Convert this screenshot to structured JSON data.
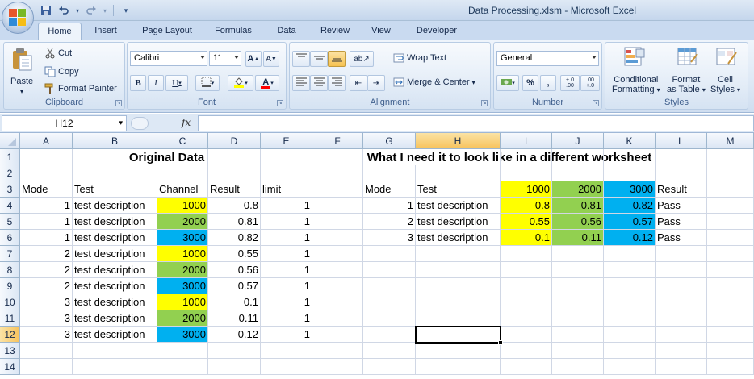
{
  "window": {
    "title": "Data Processing.xlsm - Microsoft Excel",
    "title_blurred": ""
  },
  "tabs": [
    {
      "label": "Home",
      "active": true
    },
    {
      "label": "Insert"
    },
    {
      "label": "Page Layout"
    },
    {
      "label": "Formulas"
    },
    {
      "label": "Data"
    },
    {
      "label": "Review"
    },
    {
      "label": "View"
    },
    {
      "label": "Developer"
    }
  ],
  "ribbon": {
    "clipboard": {
      "label": "Clipboard",
      "paste": "Paste",
      "cut": "Cut",
      "copy": "Copy",
      "format_painter": "Format Painter"
    },
    "font": {
      "label": "Font",
      "family": "Calibri",
      "size": "11",
      "grow": "A",
      "shrink": "A",
      "bold": "B",
      "italic": "I",
      "underline": "U",
      "font_color_letter": "A"
    },
    "alignment": {
      "label": "Alignment",
      "wrap_text": "Wrap Text",
      "merge_center": "Merge & Center"
    },
    "number": {
      "label": "Number",
      "format": "General",
      "percent": "%",
      "comma": ",",
      "inc_decimal": "+.0 .00",
      "dec_decimal": ".00 +.0"
    },
    "styles": {
      "label": "Styles",
      "conditional": "Conditional",
      "conditional2": "Formatting",
      "format_as": "Format",
      "format_as2": "as Table",
      "cell": "Cell",
      "cell2": "Styles"
    }
  },
  "formula_bar": {
    "name_box": "H12",
    "fx": "fx",
    "content": ""
  },
  "columns": [
    "A",
    "B",
    "C",
    "D",
    "E",
    "F",
    "G",
    "H",
    "I",
    "J",
    "K",
    "L",
    "M"
  ],
  "rows": [
    "1",
    "2",
    "3",
    "4",
    "5",
    "6",
    "7",
    "8",
    "9",
    "10",
    "11",
    "12",
    "13",
    "14"
  ],
  "selected": {
    "column": "H",
    "row": "12"
  },
  "sheet": {
    "title_original": "Original Data",
    "title_target": "What I need it to look like in a different worksheet",
    "orig_headers": [
      "Mode",
      "Test",
      "Channel",
      "Result",
      "limit"
    ],
    "orig_rows": [
      [
        "1",
        "test description",
        "1000",
        "0.8",
        "1"
      ],
      [
        "1",
        "test description",
        "2000",
        "0.81",
        "1"
      ],
      [
        "1",
        "test description",
        "3000",
        "0.82",
        "1"
      ],
      [
        "2",
        "test description",
        "1000",
        "0.55",
        "1"
      ],
      [
        "2",
        "test description",
        "2000",
        "0.56",
        "1"
      ],
      [
        "2",
        "test description",
        "3000",
        "0.57",
        "1"
      ],
      [
        "3",
        "test description",
        "1000",
        "0.1",
        "1"
      ],
      [
        "3",
        "test description",
        "2000",
        "0.11",
        "1"
      ],
      [
        "3",
        "test description",
        "3000",
        "0.12",
        "1"
      ]
    ],
    "target_headers": [
      "Mode",
      "Test",
      "1000",
      "2000",
      "3000",
      "Result"
    ],
    "target_rows": [
      [
        "1",
        "test description",
        "0.8",
        "0.81",
        "0.82",
        "Pass"
      ],
      [
        "2",
        "test description",
        "0.55",
        "0.56",
        "0.57",
        "Pass"
      ],
      [
        "3",
        "test description",
        "0.1",
        "0.11",
        "0.12",
        "Pass"
      ]
    ],
    "channel_colors": {
      "1000": "#ffff00",
      "2000": "#92d050",
      "3000": "#00b0f0"
    }
  }
}
